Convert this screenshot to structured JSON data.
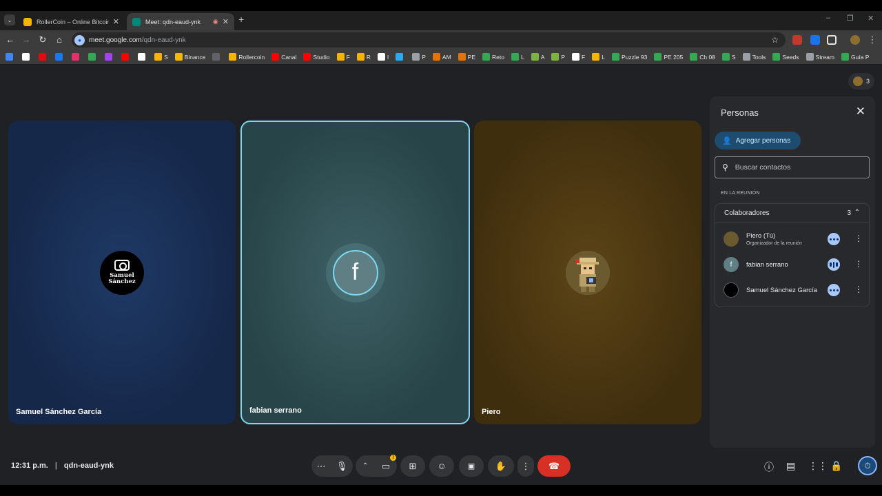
{
  "browser": {
    "tabs": [
      {
        "title": "RollerCoin – Online Bitcoin Mining",
        "favicon_color": "#f4b400"
      },
      {
        "title": "Meet: qdn-eaud-ynk",
        "favicon_color": "#00897b"
      }
    ],
    "new_tab_symbol": "+",
    "url_host": "meet.google.com",
    "url_path": "/qdn-eaud-ynk",
    "bookmarks": [
      {
        "label": "",
        "color": "#4285f4"
      },
      {
        "label": "",
        "color": "#ffffff"
      },
      {
        "label": "",
        "color": "#e50914"
      },
      {
        "label": "",
        "color": "#1877f2"
      },
      {
        "label": "",
        "color": "#e1306c"
      },
      {
        "label": "",
        "color": "#34a853"
      },
      {
        "label": "",
        "color": "#a142f4"
      },
      {
        "label": "",
        "color": "#ff0000"
      },
      {
        "label": "",
        "color": "#ffffff"
      },
      {
        "label": "S",
        "color": "#f4b400"
      },
      {
        "label": "Binance",
        "color": "#f0b90b"
      },
      {
        "label": "",
        "color": "#5f6368"
      },
      {
        "label": "Rollercoin",
        "color": "#f4b400"
      },
      {
        "label": "Canal",
        "color": "#ff0000"
      },
      {
        "label": "Studio",
        "color": "#ff0000"
      },
      {
        "label": "F",
        "color": "#f4b400"
      },
      {
        "label": "R",
        "color": "#f4b400"
      },
      {
        "label": "I",
        "color": "#ffffff"
      },
      {
        "label": "",
        "color": "#2aabee"
      },
      {
        "label": "P",
        "color": "#9aa0a6"
      },
      {
        "label": "AM",
        "color": "#e37400"
      },
      {
        "label": "PE",
        "color": "#e37400"
      },
      {
        "label": "Reto",
        "color": "#34a853"
      },
      {
        "label": "L",
        "color": "#34a853"
      },
      {
        "label": "A",
        "color": "#7cb342"
      },
      {
        "label": "P",
        "color": "#7cb342"
      },
      {
        "label": "F",
        "color": "#ffffff"
      },
      {
        "label": "L",
        "color": "#f4b400"
      },
      {
        "label": "Puzzle 93",
        "color": "#34a853"
      },
      {
        "label": "PE 205",
        "color": "#34a853"
      },
      {
        "label": "Ch 08",
        "color": "#34a853"
      },
      {
        "label": "S",
        "color": "#34a853"
      },
      {
        "label": "Tools",
        "color": "#9aa0a6"
      },
      {
        "label": "Seeds",
        "color": "#34a853"
      },
      {
        "label": "Stream",
        "color": "#9aa0a6"
      },
      {
        "label": "Guía P",
        "color": "#34a853"
      }
    ]
  },
  "meeting": {
    "participant_count": "3",
    "tiles": [
      {
        "name": "Samuel Sánchez García",
        "avatar_text": "Samuel Sánchez"
      },
      {
        "name": "fabian serrano",
        "avatar_text": "f"
      },
      {
        "name": "Piero"
      }
    ]
  },
  "panel": {
    "title": "Personas",
    "add_button": "Agregar personas",
    "search_placeholder": "Buscar contactos",
    "section_label": "EN LA REUNIÓN",
    "group_label": "Colaboradores",
    "group_count": "3",
    "people": [
      {
        "name": "Piero (Tú)",
        "subtitle": "Organizador de la reunión",
        "avatar": "",
        "status": "muted"
      },
      {
        "name": "fabian serrano",
        "subtitle": "",
        "avatar": "f",
        "status": "speaking"
      },
      {
        "name": "Samuel Sánchez García",
        "subtitle": "",
        "avatar": "",
        "status": "muted"
      }
    ]
  },
  "bottom": {
    "time": "12:31 p.m.",
    "meeting_code": "qdn-eaud-ynk",
    "warning": "!"
  },
  "colors": {
    "accent_blue": "#a8c7fa",
    "end_call_red": "#d93025",
    "active_speaker_border": "#7cd7f0"
  }
}
